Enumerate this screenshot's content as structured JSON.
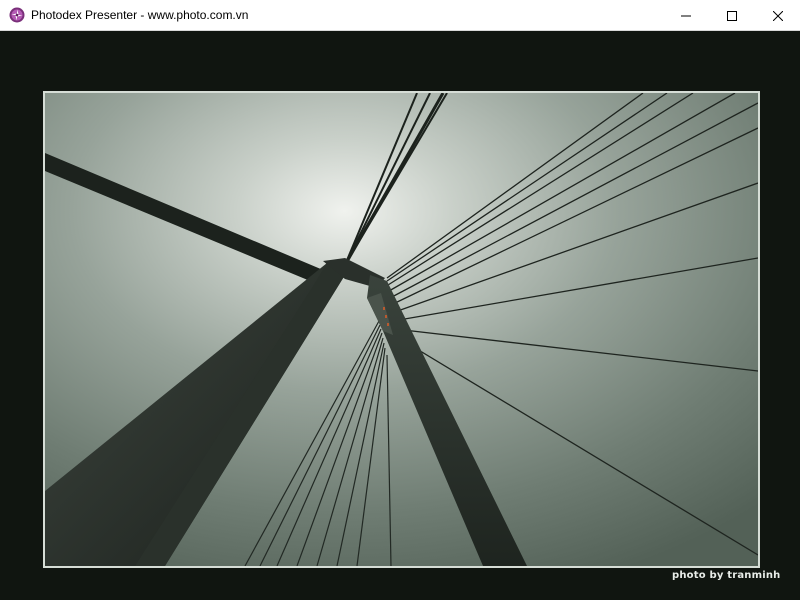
{
  "window": {
    "title": "Photodex Presenter - www.photo.com.vn",
    "icon": "photodex-app-icon",
    "controls": {
      "minimize_icon": "minimize-icon",
      "maximize_icon": "maximize-icon",
      "close_icon": "close-icon"
    }
  },
  "slide": {
    "photo_subject": "cable-stayed-bridge-pylon-photo",
    "credit": "photo by tranminh"
  }
}
